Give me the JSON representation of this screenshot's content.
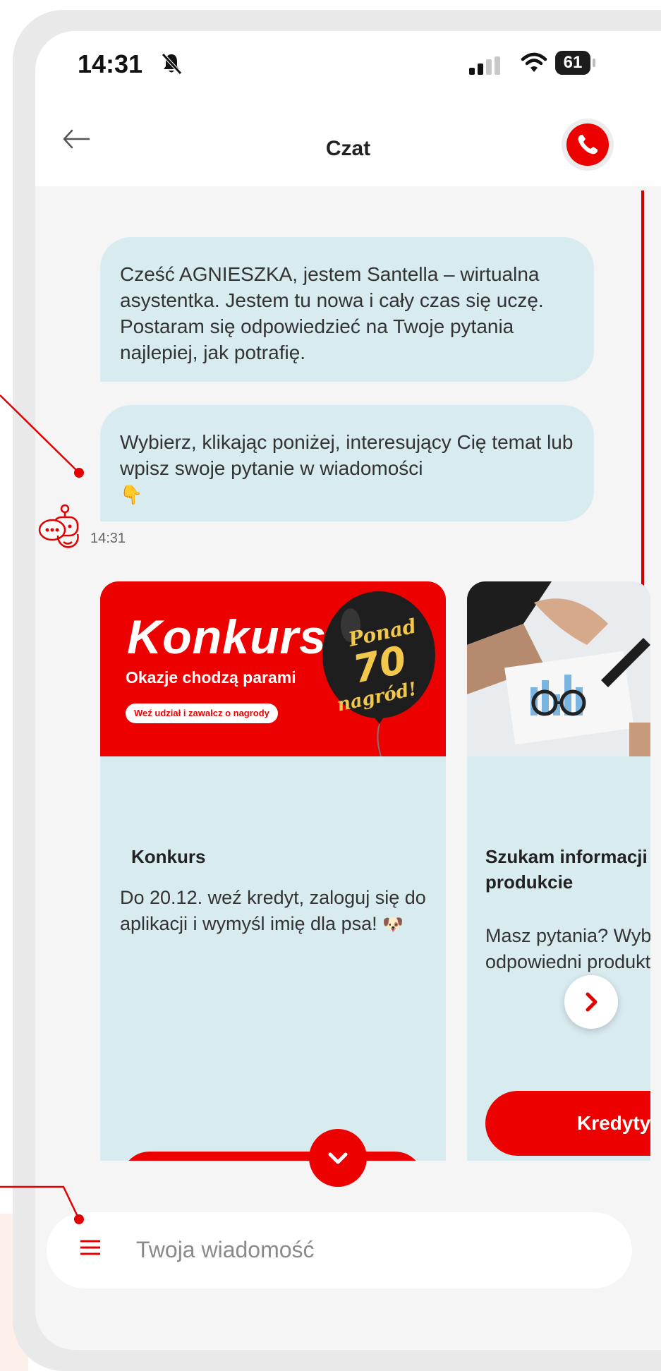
{
  "status_bar": {
    "time": "14:31",
    "battery": "61"
  },
  "header": {
    "title": "Czat"
  },
  "messages": [
    {
      "text": "Cześć AGNIESZKA, jestem Santella – wirtualna asystentka. Jestem tu nowa i cały czas się uczę. Postaram się odpowiedzieć na Twoje pytania najlepiej, jak potrafię."
    },
    {
      "text": "Wybierz, klikając poniżej, interesujący Cię temat lub wpisz swoje pytanie w wiadomości",
      "emoji": "👇"
    }
  ],
  "message_time": "14:31",
  "cards": [
    {
      "banner": {
        "big": "Konkurs",
        "sub": "Okazje chodzą parami",
        "pill": "Weź udział i zawalcz o nagrody",
        "balloon_top": "Ponad",
        "balloon_num": "70",
        "balloon_bottom": "nagród!"
      },
      "title": "Konkurs",
      "text": "Do 20.12. weź kredyt, zaloguj się do aplikacji i wymyśl imię dla psa!",
      "emoji": "🐶"
    },
    {
      "title": "Szukam informacji o produkcie",
      "text": "Masz pytania? Wybierz odpowiedni produkt",
      "button": "Kredyty"
    }
  ],
  "input": {
    "placeholder": "Twoja wiadomość"
  },
  "colors": {
    "brand": "#ec0000",
    "bubble": "#d8ebef"
  }
}
